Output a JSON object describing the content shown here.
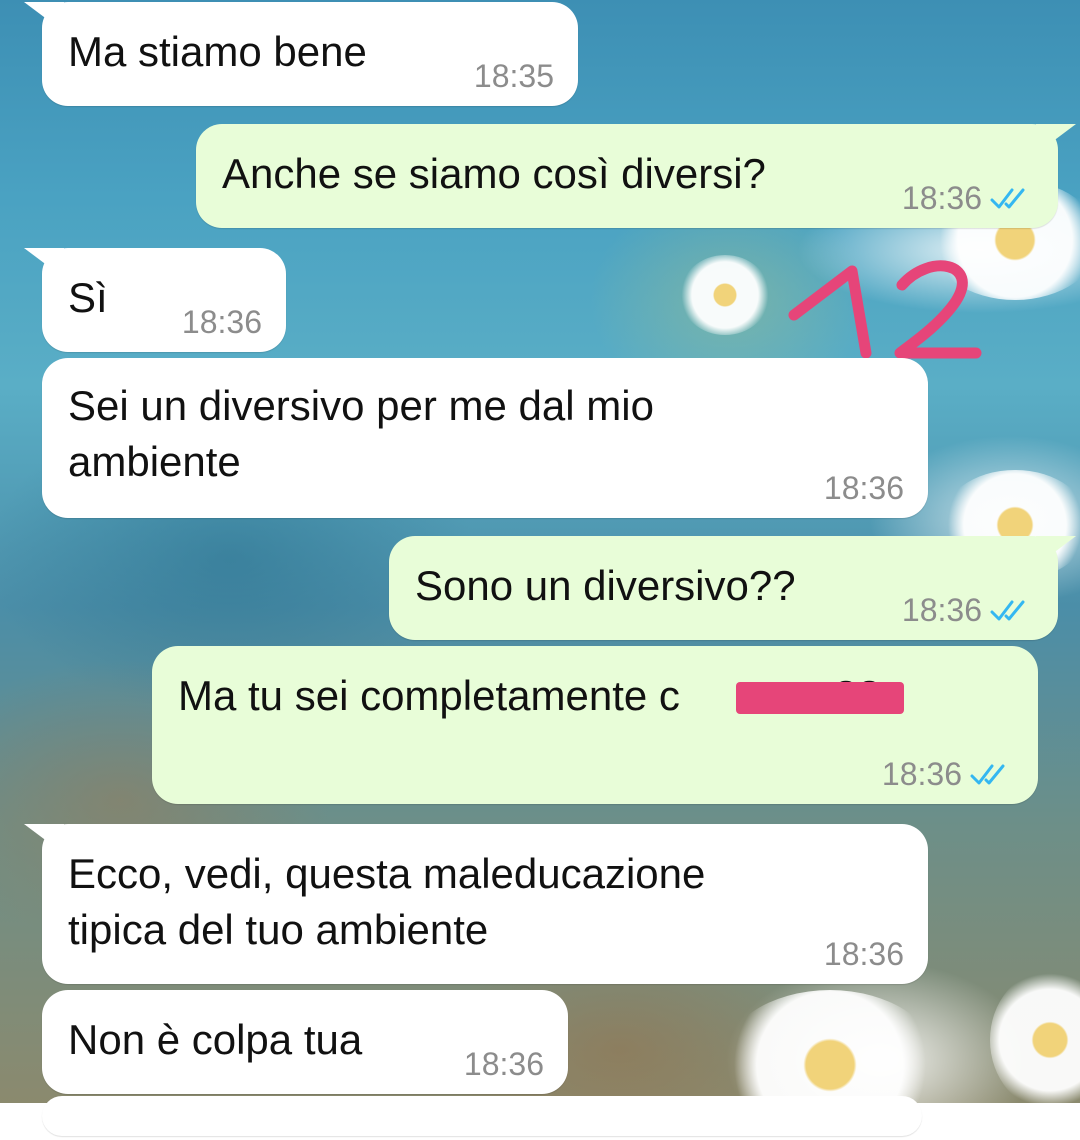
{
  "chat": {
    "messages": [
      {
        "id": "m1",
        "direction": "incoming",
        "text": "Ma stiamo bene",
        "time": "18:35"
      },
      {
        "id": "m2",
        "direction": "outgoing",
        "text": "Anche se siamo così diversi?",
        "time": "18:36",
        "status": "read"
      },
      {
        "id": "m3",
        "direction": "incoming",
        "text": "Sì",
        "time": "18:36"
      },
      {
        "id": "m4",
        "direction": "incoming",
        "lines": [
          "Sei un diversivo per me dal mio",
          "ambiente"
        ],
        "time": "18:36"
      },
      {
        "id": "m5",
        "direction": "outgoing",
        "text": "Sono un diversivo??",
        "time": "18:36",
        "status": "read"
      },
      {
        "id": "m6",
        "direction": "outgoing",
        "text": "Ma tu sei completamente c",
        "text_end": "??",
        "time": "18:36",
        "status": "read",
        "redacted": true
      },
      {
        "id": "m7",
        "direction": "incoming",
        "lines": [
          "Ecco, vedi, questa maleducazione",
          "tipica del tuo ambiente"
        ],
        "time": "18:36"
      },
      {
        "id": "m8",
        "direction": "incoming",
        "text": "Non è colpa tua",
        "time": "18:36"
      }
    ]
  },
  "annotation": {
    "text": "12",
    "color": "#e64579"
  },
  "colors": {
    "incoming_bubble": "#ffffff",
    "outgoing_bubble": "#e8fdd8",
    "read_ticks": "#34b7f1",
    "timestamp": "#8c8c8c"
  },
  "icons": {
    "read_receipt": "double-check-icon"
  }
}
